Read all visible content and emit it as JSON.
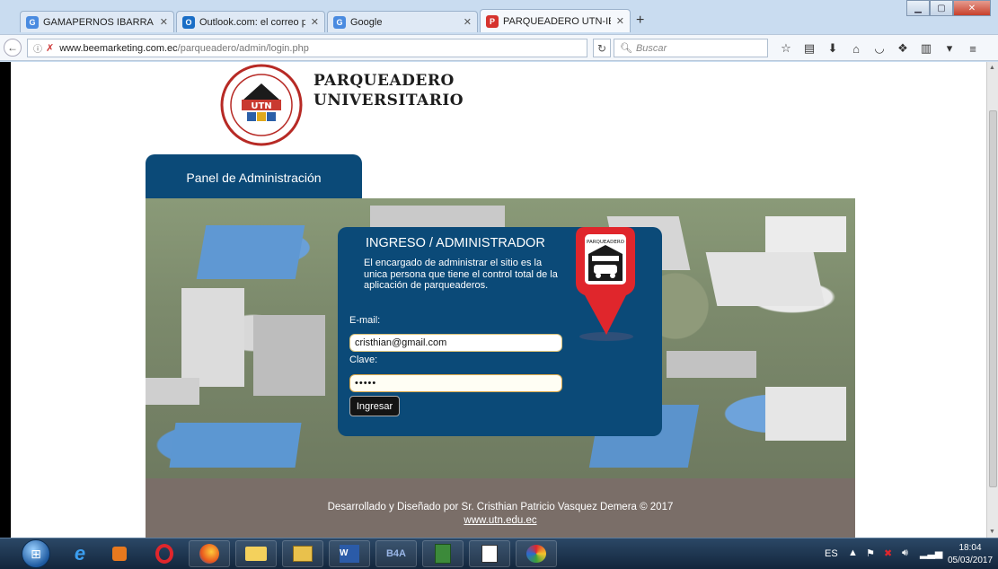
{
  "browser": {
    "tabs": [
      {
        "title": "GAMAPERNOS IBARRA - B...",
        "favicon": "G",
        "color": "#4a8be0"
      },
      {
        "title": "Outlook.com: el correo per...",
        "favicon": "O",
        "color": "#1a6ec6"
      },
      {
        "title": "Google",
        "favicon": "G",
        "color": "#4a8be0"
      },
      {
        "title": "PARQUEADERO UTN-IBAR...",
        "favicon": "P",
        "color": "#d6332d"
      }
    ],
    "new_tab": "+",
    "url_host": "www.beemarketing.com.ec",
    "url_path": "/parqueadero/admin/login.php",
    "search_placeholder": "Buscar"
  },
  "site": {
    "title_line1": "PARQUEADERO",
    "title_line2": "UNIVERSITARIO",
    "logo_text": "UTN"
  },
  "admin_tab": "Panel de Administración",
  "login": {
    "title": "INGRESO / ADMINISTRADOR",
    "description": "El encargado de administrar el sitio es la unica persona que tiene el control total de la aplicación de parqueaderos.",
    "email_label": "E-mail:",
    "email_value": "cristhian@gmail.com",
    "clave_label": "Clave:",
    "clave_value": "•••••",
    "submit_label": "Ingresar"
  },
  "pin_label": "PARQUEADERO",
  "footer": {
    "credit": "Desarrollado y Diseñado por Sr. Cristhian Patricio Vasquez Demera © 2017",
    "link": "www.utn.edu.ec"
  },
  "taskbar": {
    "language": "ES",
    "time": "18:04",
    "date": "05/03/2017"
  }
}
